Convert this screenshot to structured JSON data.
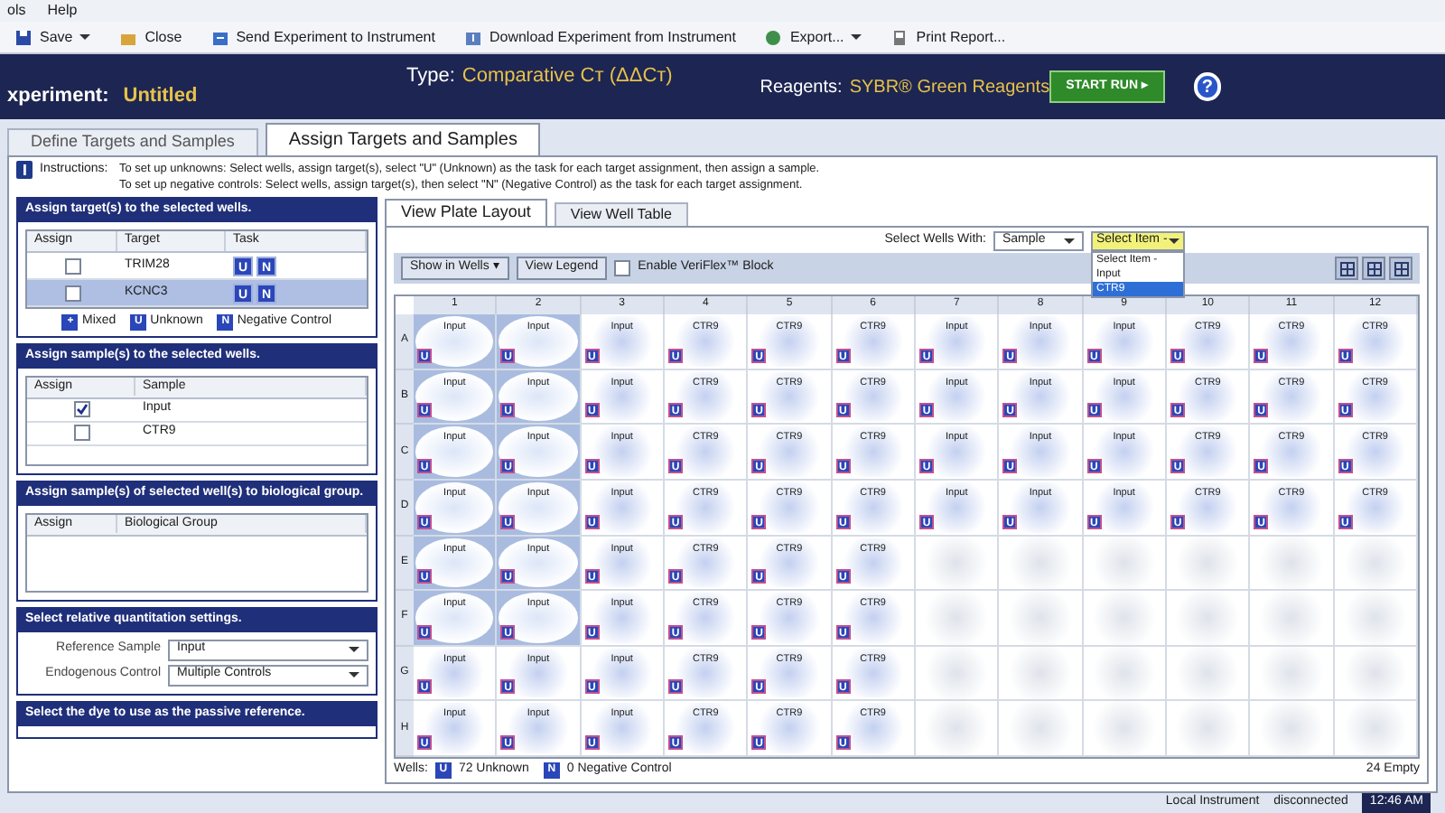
{
  "menu": [
    "ols",
    "Help"
  ],
  "toolbar": [
    {
      "label": "Save",
      "dropdown": true
    },
    {
      "label": "Close",
      "dropdown": false
    },
    {
      "label": "Send Experiment to Instrument",
      "dropdown": false
    },
    {
      "label": "Download Experiment from Instrument",
      "dropdown": false
    },
    {
      "label": "Export...",
      "dropdown": true
    },
    {
      "label": "Print Report...",
      "dropdown": false
    }
  ],
  "header": {
    "experiment_label": "xperiment:",
    "experiment": "Untitled",
    "type_label": "Type:",
    "type": "Comparative Cт (ΔΔCт)",
    "reagents_label": "Reagents:",
    "reagents": "SYBR® Green Reagents",
    "start_button": "START RUN ▸",
    "help": "?"
  },
  "tabs": [
    {
      "label": "Define Targets and Samples",
      "selected": false
    },
    {
      "label": "Assign Targets and Samples",
      "selected": true
    }
  ],
  "instructions": {
    "label": "Instructions:",
    "lines": [
      "To set up unknowns: Select wells, assign target(s), select \"U\" (Unknown) as the task for each target assignment, then assign a sample.",
      "To set up negative controls: Select wells, assign target(s), then select \"N\" (Negative Control) as the task for each target assignment."
    ]
  },
  "targets": {
    "title": "Assign target(s) to the selected wells.",
    "columns": [
      "Assign",
      "Target",
      "Task"
    ],
    "rows": [
      {
        "target": "TRIM28",
        "checked": false,
        "selected": false,
        "tasks": [
          "U",
          "N"
        ]
      },
      {
        "target": "KCNC3",
        "checked": false,
        "selected": true,
        "tasks": [
          "U",
          "N"
        ]
      }
    ],
    "legend": [
      {
        "icon": "+",
        "label": "Mixed"
      },
      {
        "icon": "U",
        "label": "Unknown"
      },
      {
        "icon": "N",
        "label": "Negative Control"
      }
    ]
  },
  "samples": {
    "title": "Assign sample(s) to the selected wells.",
    "columns": [
      "Assign",
      "Sample"
    ],
    "rows": [
      {
        "sample": "Input",
        "checked": true
      },
      {
        "sample": "CTR9",
        "checked": false
      }
    ]
  },
  "groups": {
    "title": "Assign sample(s) of selected well(s) to biological group.",
    "columns": [
      "Assign",
      "Biological Group"
    ]
  },
  "rq": {
    "title": "Select relative quantitation settings.",
    "fields": [
      {
        "label": "Reference Sample",
        "value": "Input"
      },
      {
        "label": "Endogenous Control",
        "value": "Multiple Controls"
      }
    ]
  },
  "passive": {
    "title": "Select the dye to use as the passive reference."
  },
  "view_tabs": [
    {
      "label": "View Plate Layout",
      "selected": true
    },
    {
      "label": "View Well Table",
      "selected": false
    }
  ],
  "select_wells": {
    "label": "Select Wells With:",
    "field": "Sample",
    "item": "Select Item -",
    "options": [
      {
        "label": "Select Item -",
        "selected": false
      },
      {
        "label": "Input",
        "selected": false
      },
      {
        "label": "CTR9",
        "selected": true
      }
    ]
  },
  "plate_toolbar": {
    "show_in_wells": "Show in Wells ▾",
    "view_legend": "View Legend",
    "veriflex": {
      "label": "Enable VeriFlex™ Block",
      "checked": false
    }
  },
  "plate": {
    "columns": [
      "1",
      "2",
      "3",
      "4",
      "5",
      "6",
      "7",
      "8",
      "9",
      "10",
      "11",
      "12"
    ],
    "rows": [
      {
        "label": "A",
        "wells": [
          {
            "kind": "sample",
            "sample": "Input",
            "task": "U",
            "selected": true
          },
          {
            "kind": "sample",
            "sample": "Input",
            "task": "U",
            "selected": true
          },
          {
            "kind": "sample",
            "sample": "Input",
            "task": "U",
            "selected": false
          },
          {
            "kind": "sample",
            "sample": "CTR9",
            "task": "U",
            "selected": false
          },
          {
            "kind": "sample",
            "sample": "CTR9",
            "task": "U",
            "selected": false
          },
          {
            "kind": "sample",
            "sample": "CTR9",
            "task": "U",
            "selected": false
          },
          {
            "kind": "sample",
            "sample": "Input",
            "task": "U",
            "selected": false
          },
          {
            "kind": "sample",
            "sample": "Input",
            "task": "U",
            "selected": false
          },
          {
            "kind": "sample",
            "sample": "Input",
            "task": "U",
            "selected": false
          },
          {
            "kind": "sample",
            "sample": "CTR9",
            "task": "U",
            "selected": false
          },
          {
            "kind": "sample",
            "sample": "CTR9",
            "task": "U",
            "selected": false
          },
          {
            "kind": "sample",
            "sample": "CTR9",
            "task": "U",
            "selected": false
          }
        ]
      },
      {
        "label": "B",
        "wells": [
          {
            "kind": "sample",
            "sample": "Input",
            "task": "U",
            "selected": true
          },
          {
            "kind": "sample",
            "sample": "Input",
            "task": "U",
            "selected": true
          },
          {
            "kind": "sample",
            "sample": "Input",
            "task": "U",
            "selected": false
          },
          {
            "kind": "sample",
            "sample": "CTR9",
            "task": "U",
            "selected": false
          },
          {
            "kind": "sample",
            "sample": "CTR9",
            "task": "U",
            "selected": false
          },
          {
            "kind": "sample",
            "sample": "CTR9",
            "task": "U",
            "selected": false
          },
          {
            "kind": "sample",
            "sample": "Input",
            "task": "U",
            "selected": false
          },
          {
            "kind": "sample",
            "sample": "Input",
            "task": "U",
            "selected": false
          },
          {
            "kind": "sample",
            "sample": "Input",
            "task": "U",
            "selected": false
          },
          {
            "kind": "sample",
            "sample": "CTR9",
            "task": "U",
            "selected": false
          },
          {
            "kind": "sample",
            "sample": "CTR9",
            "task": "U",
            "selected": false
          },
          {
            "kind": "sample",
            "sample": "CTR9",
            "task": "U",
            "selected": false
          }
        ]
      },
      {
        "label": "C",
        "wells": [
          {
            "kind": "sample",
            "sample": "Input",
            "task": "U",
            "selected": true
          },
          {
            "kind": "sample",
            "sample": "Input",
            "task": "U",
            "selected": true
          },
          {
            "kind": "sample",
            "sample": "Input",
            "task": "U",
            "selected": false
          },
          {
            "kind": "sample",
            "sample": "CTR9",
            "task": "U",
            "selected": false
          },
          {
            "kind": "sample",
            "sample": "CTR9",
            "task": "U",
            "selected": false
          },
          {
            "kind": "sample",
            "sample": "CTR9",
            "task": "U",
            "selected": false
          },
          {
            "kind": "sample",
            "sample": "Input",
            "task": "U",
            "selected": false
          },
          {
            "kind": "sample",
            "sample": "Input",
            "task": "U",
            "selected": false
          },
          {
            "kind": "sample",
            "sample": "Input",
            "task": "U",
            "selected": false
          },
          {
            "kind": "sample",
            "sample": "CTR9",
            "task": "U",
            "selected": false
          },
          {
            "kind": "sample",
            "sample": "CTR9",
            "task": "U",
            "selected": false
          },
          {
            "kind": "sample",
            "sample": "CTR9",
            "task": "U",
            "selected": false
          }
        ]
      },
      {
        "label": "D",
        "wells": [
          {
            "kind": "sample",
            "sample": "Input",
            "task": "U",
            "selected": true
          },
          {
            "kind": "sample",
            "sample": "Input",
            "task": "U",
            "selected": true
          },
          {
            "kind": "sample",
            "sample": "Input",
            "task": "U",
            "selected": false
          },
          {
            "kind": "sample",
            "sample": "CTR9",
            "task": "U",
            "selected": false
          },
          {
            "kind": "sample",
            "sample": "CTR9",
            "task": "U",
            "selected": false
          },
          {
            "kind": "sample",
            "sample": "CTR9",
            "task": "U",
            "selected": false
          },
          {
            "kind": "sample",
            "sample": "Input",
            "task": "U",
            "selected": false
          },
          {
            "kind": "sample",
            "sample": "Input",
            "task": "U",
            "selected": false
          },
          {
            "kind": "sample",
            "sample": "Input",
            "task": "U",
            "selected": false
          },
          {
            "kind": "sample",
            "sample": "CTR9",
            "task": "U",
            "selected": false
          },
          {
            "kind": "sample",
            "sample": "CTR9",
            "task": "U",
            "selected": false
          },
          {
            "kind": "sample",
            "sample": "CTR9",
            "task": "U",
            "selected": false
          }
        ]
      },
      {
        "label": "E",
        "wells": [
          {
            "kind": "sample",
            "sample": "Input",
            "task": "U",
            "selected": true
          },
          {
            "kind": "sample",
            "sample": "Input",
            "task": "U",
            "selected": true
          },
          {
            "kind": "sample",
            "sample": "Input",
            "task": "U",
            "selected": false
          },
          {
            "kind": "sample",
            "sample": "CTR9",
            "task": "U",
            "selected": false
          },
          {
            "kind": "sample",
            "sample": "CTR9",
            "task": "U",
            "selected": false
          },
          {
            "kind": "sample",
            "sample": "CTR9",
            "task": "U",
            "selected": false
          },
          {
            "kind": "empty"
          },
          {
            "kind": "empty"
          },
          {
            "kind": "empty"
          },
          {
            "kind": "empty"
          },
          {
            "kind": "empty"
          },
          {
            "kind": "empty"
          }
        ]
      },
      {
        "label": "F",
        "wells": [
          {
            "kind": "sample",
            "sample": "Input",
            "task": "U",
            "selected": true
          },
          {
            "kind": "sample",
            "sample": "Input",
            "task": "U",
            "selected": true
          },
          {
            "kind": "sample",
            "sample": "Input",
            "task": "U",
            "selected": false
          },
          {
            "kind": "sample",
            "sample": "CTR9",
            "task": "U",
            "selected": false
          },
          {
            "kind": "sample",
            "sample": "CTR9",
            "task": "U",
            "selected": false
          },
          {
            "kind": "sample",
            "sample": "CTR9",
            "task": "U",
            "selected": false
          },
          {
            "kind": "empty"
          },
          {
            "kind": "empty"
          },
          {
            "kind": "empty"
          },
          {
            "kind": "empty"
          },
          {
            "kind": "empty"
          },
          {
            "kind": "empty"
          }
        ]
      },
      {
        "label": "G",
        "wells": [
          {
            "kind": "sample",
            "sample": "Input",
            "task": "U",
            "selected": false
          },
          {
            "kind": "sample",
            "sample": "Input",
            "task": "U",
            "selected": false
          },
          {
            "kind": "sample",
            "sample": "Input",
            "task": "U",
            "selected": false
          },
          {
            "kind": "sample",
            "sample": "CTR9",
            "task": "U",
            "selected": false
          },
          {
            "kind": "sample",
            "sample": "CTR9",
            "task": "U",
            "selected": false
          },
          {
            "kind": "sample",
            "sample": "CTR9",
            "task": "U",
            "selected": false
          },
          {
            "kind": "empty"
          },
          {
            "kind": "empty"
          },
          {
            "kind": "empty"
          },
          {
            "kind": "empty"
          },
          {
            "kind": "empty"
          },
          {
            "kind": "empty"
          }
        ]
      },
      {
        "label": "H",
        "wells": [
          {
            "kind": "sample",
            "sample": "Input",
            "task": "U",
            "selected": false
          },
          {
            "kind": "sample",
            "sample": "Input",
            "task": "U",
            "selected": false
          },
          {
            "kind": "sample",
            "sample": "Input",
            "task": "U",
            "selected": false
          },
          {
            "kind": "sample",
            "sample": "CTR9",
            "task": "U",
            "selected": false
          },
          {
            "kind": "sample",
            "sample": "CTR9",
            "task": "U",
            "selected": false
          },
          {
            "kind": "sample",
            "sample": "CTR9",
            "task": "U",
            "selected": false
          },
          {
            "kind": "empty"
          },
          {
            "kind": "empty"
          },
          {
            "kind": "empty"
          },
          {
            "kind": "empty"
          },
          {
            "kind": "empty"
          },
          {
            "kind": "empty"
          }
        ]
      }
    ]
  },
  "plate_footer": {
    "label": "Wells:",
    "counts": [
      {
        "icon": "U",
        "label": "72 Unknown"
      },
      {
        "icon": "N",
        "label": "0 Negative Control"
      }
    ],
    "empty": "24 Empty"
  },
  "status_bar": {
    "instrument": "Local Instrument",
    "state": "disconnected",
    "time": "12:46 AM"
  }
}
